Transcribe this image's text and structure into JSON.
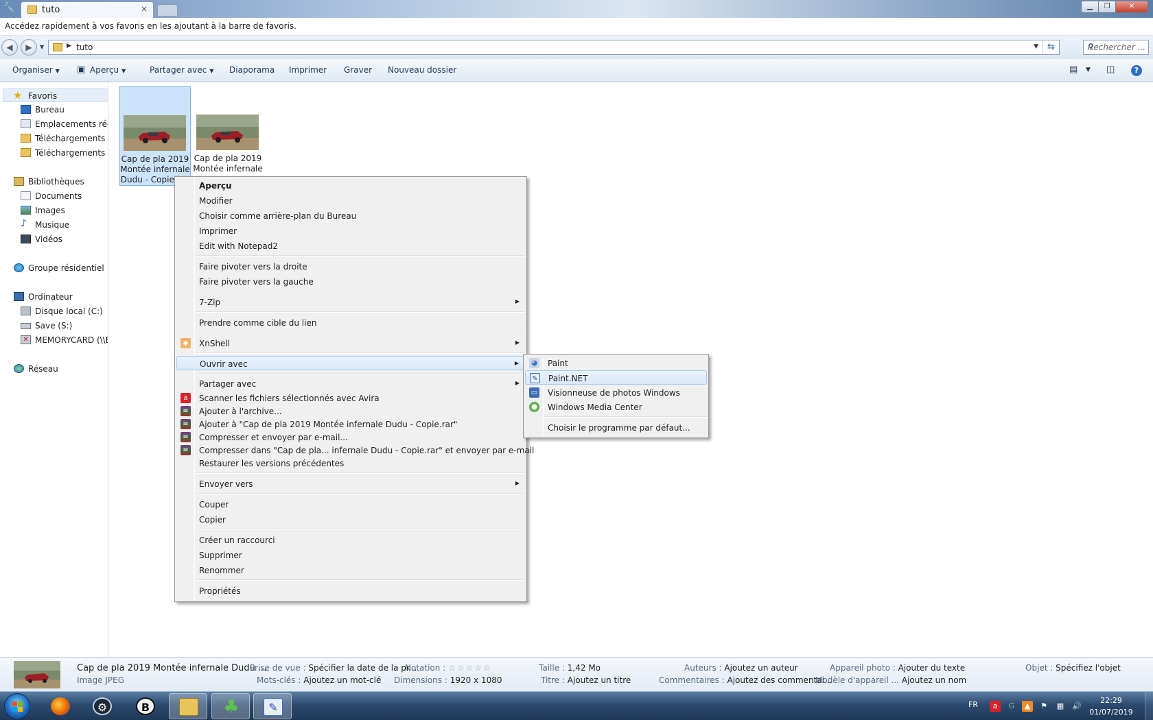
{
  "window": {
    "tab_title": "tuto",
    "favorites_hint": "Accédez rapidement à vos favoris en les ajoutant à la barre de favoris.",
    "address_path": "tuto",
    "search_placeholder": "Rechercher ...",
    "close_tab": "×"
  },
  "toolbar": {
    "organiser": "Organiser",
    "apercu": "Aperçu",
    "partager": "Partager avec",
    "diaporama": "Diaporama",
    "imprimer": "Imprimer",
    "graver": "Graver",
    "nouveau_dossier": "Nouveau dossier"
  },
  "sidebar": {
    "favoris": "Favoris",
    "bureau": "Bureau",
    "emplacements": "Emplacements récents",
    "telechargements1": "Téléchargements",
    "telechargements2": "Téléchargements",
    "bibliotheques": "Bibliothèques",
    "documents": "Documents",
    "images": "Images",
    "musique": "Musique",
    "videos": "Vidéos",
    "groupe": "Groupe résidentiel",
    "ordinateur": "Ordinateur",
    "disque_c": "Disque local (C:)",
    "save_s": "Save (S:)",
    "memorycard": "MEMORYCARD (\\\\E",
    "reseau": "Réseau"
  },
  "files": [
    {
      "line1": "Cap de pla 2019",
      "line2": "Montée infernale",
      "line3": "Dudu - Copie.jpg"
    },
    {
      "line1": "Cap de pla 2019",
      "line2": "Montée infernale",
      "line3": ""
    }
  ],
  "context_menu": {
    "apercu": "Aperçu",
    "modifier": "Modifier",
    "arriere_plan": "Choisir comme arrière-plan du Bureau",
    "imprimer": "Imprimer",
    "notepad2": "Edit with Notepad2",
    "pivoter_droite": "Faire pivoter vers la droite",
    "pivoter_gauche": "Faire pivoter vers la gauche",
    "zip": "7-Zip",
    "cible_lien": "Prendre comme cible du lien",
    "xnshell": "XnShell",
    "ouvrir_avec": "Ouvrir avec",
    "partager_avec": "Partager avec",
    "avira": "Scanner les fichiers sélectionnés avec Avira",
    "ajouter_archive": "Ajouter à l'archive...",
    "ajouter_rar": "Ajouter à \"Cap de pla 2019 Montée infernale Dudu - Copie.rar\"",
    "compresser_email": "Compresser et envoyer par e-mail...",
    "compresser_dans": "Compresser dans \"Cap de pla... infernale Dudu - Copie.rar\" et envoyer par e-mail",
    "restaurer": "Restaurer les versions précédentes",
    "envoyer_vers": "Envoyer vers",
    "couper": "Couper",
    "copier": "Copier",
    "raccourci": "Créer un raccourci",
    "supprimer": "Supprimer",
    "renommer": "Renommer",
    "proprietes": "Propriétés"
  },
  "submenu": {
    "paint": "Paint",
    "paintnet": "Paint.NET",
    "visionneuse": "Visionneuse de photos Windows",
    "media_center": "Windows Media Center",
    "defaut": "Choisir le programme par défaut..."
  },
  "details": {
    "filename": "Cap de pla 2019 Montée infernale Dudu ...",
    "filetype": "Image JPEG",
    "prise_de_vue_k": "Prise de vue :",
    "prise_de_vue_v": "Spécifier la date de la pr...",
    "mots_cles_k": "Mots-clés :",
    "mots_cles_v": "Ajoutez un mot-clé",
    "notation_k": "Notation :",
    "notation_v": "☆☆☆☆☆",
    "dimensions_k": "Dimensions :",
    "dimensions_v": "1920 x 1080",
    "taille_k": "Taille :",
    "taille_v": "1,42 Mo",
    "titre_k": "Titre :",
    "titre_v": "Ajoutez un titre",
    "auteurs_k": "Auteurs :",
    "auteurs_v": "Ajoutez un auteur",
    "commentaires_k": "Commentaires :",
    "commentaires_v": "Ajoutez des commentai...",
    "appareil_k": "Appareil photo :",
    "appareil_v": "Ajouter du texte",
    "modele_k": "Modèle d'appareil ...",
    "modele_v": "Ajoutez un nom",
    "objet_k": "Objet :",
    "objet_v": "Spécifiez l'objet"
  },
  "taskbar": {
    "lang": "FR",
    "time": "22:29",
    "date": "01/07/2019"
  }
}
